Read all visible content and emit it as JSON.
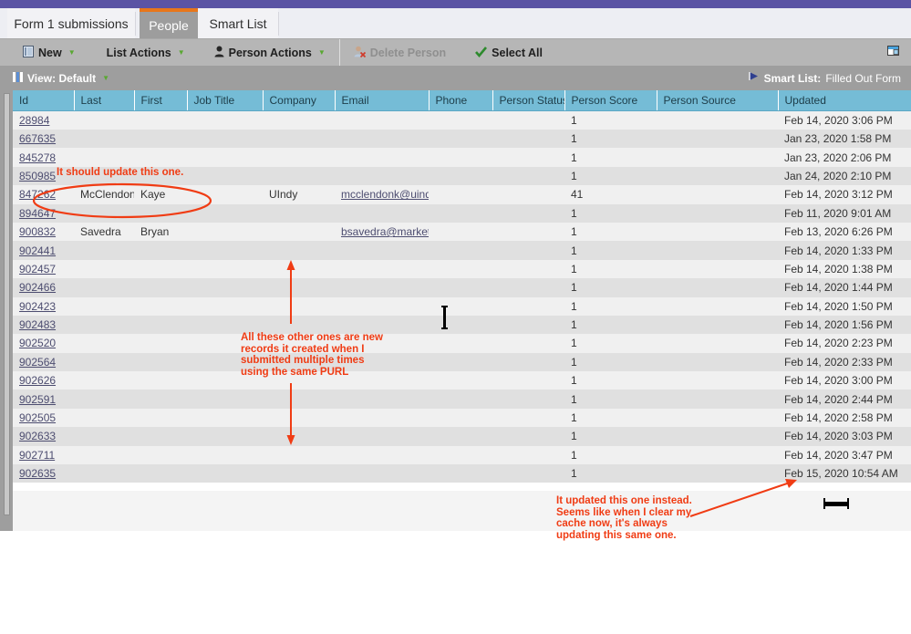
{
  "window": {
    "accent_purple": "#5b54a4",
    "active_tab_accent": "#e8761a",
    "annotation_color": "#f03c14"
  },
  "tabs": [
    {
      "label": "Form 1 submissions",
      "active": false
    },
    {
      "label": "People",
      "active": true
    },
    {
      "label": "Smart List",
      "active": false
    }
  ],
  "toolbar": {
    "new_label": "New",
    "list_actions_label": "List Actions",
    "person_actions_label": "Person Actions",
    "delete_person_label": "Delete Person",
    "select_all_label": "Select All",
    "new_icon": "document-icon",
    "person_icon": "person-icon",
    "delete_icon": "delete-person-icon",
    "select_all_icon": "checkmark-icon",
    "window_icon": "window-restore-icon"
  },
  "viewbar": {
    "view_icon": "columns-icon",
    "view_label": "View: Default",
    "smart_list_icon": "flag-icon",
    "smart_list_label": "Smart List:",
    "smart_list_value": "Filled Out Form"
  },
  "table": {
    "columns": [
      "Id",
      "Last",
      "First",
      "Job Title",
      "Company",
      "Email",
      "Phone",
      "Person Status",
      "Person Score",
      "Person Source",
      "Updated"
    ],
    "rows": [
      {
        "id": "28984",
        "last": "",
        "first": "",
        "job_title": "",
        "company": "",
        "email": "",
        "phone": "",
        "person_status": "",
        "person_score": "1",
        "person_source": "",
        "updated": "Feb 14, 2020 3:06 PM"
      },
      {
        "id": "667635",
        "last": "",
        "first": "",
        "job_title": "",
        "company": "",
        "email": "",
        "phone": "",
        "person_status": "",
        "person_score": "1",
        "person_source": "",
        "updated": "Jan 23, 2020 1:58 PM"
      },
      {
        "id": "845278",
        "last": "",
        "first": "",
        "job_title": "",
        "company": "",
        "email": "",
        "phone": "",
        "person_status": "",
        "person_score": "1",
        "person_source": "",
        "updated": "Jan 23, 2020 2:06 PM"
      },
      {
        "id": "850985",
        "last": "",
        "first": "",
        "job_title": "",
        "company": "",
        "email": "",
        "phone": "",
        "person_status": "",
        "person_score": "1",
        "person_source": "",
        "updated": "Jan 24, 2020 2:10 PM"
      },
      {
        "id": "847262",
        "last": "McClendon",
        "first": "Kaye",
        "job_title": "",
        "company": "UIndy",
        "email": "mcclendonk@uind...",
        "phone": "",
        "person_status": "",
        "person_score": "41",
        "person_source": "",
        "updated": "Feb 14, 2020 3:12 PM"
      },
      {
        "id": "894647",
        "last": "",
        "first": "",
        "job_title": "",
        "company": "",
        "email": "",
        "phone": "",
        "person_status": "",
        "person_score": "1",
        "person_source": "",
        "updated": "Feb 11, 2020 9:01 AM"
      },
      {
        "id": "900832",
        "last": "Savedra",
        "first": "Bryan",
        "job_title": "",
        "company": "",
        "email": "bsavedra@market...",
        "phone": "",
        "person_status": "",
        "person_score": "1",
        "person_source": "",
        "updated": "Feb 13, 2020 6:26 PM"
      },
      {
        "id": "902441",
        "last": "",
        "first": "",
        "job_title": "",
        "company": "",
        "email": "",
        "phone": "",
        "person_status": "",
        "person_score": "1",
        "person_source": "",
        "updated": "Feb 14, 2020 1:33 PM"
      },
      {
        "id": "902457",
        "last": "",
        "first": "",
        "job_title": "",
        "company": "",
        "email": "",
        "phone": "",
        "person_status": "",
        "person_score": "1",
        "person_source": "",
        "updated": "Feb 14, 2020 1:38 PM"
      },
      {
        "id": "902466",
        "last": "",
        "first": "",
        "job_title": "",
        "company": "",
        "email": "",
        "phone": "",
        "person_status": "",
        "person_score": "1",
        "person_source": "",
        "updated": "Feb 14, 2020 1:44 PM"
      },
      {
        "id": "902423",
        "last": "",
        "first": "",
        "job_title": "",
        "company": "",
        "email": "",
        "phone": "",
        "person_status": "",
        "person_score": "1",
        "person_source": "",
        "updated": "Feb 14, 2020 1:50 PM"
      },
      {
        "id": "902483",
        "last": "",
        "first": "",
        "job_title": "",
        "company": "",
        "email": "",
        "phone": "",
        "person_status": "",
        "person_score": "1",
        "person_source": "",
        "updated": "Feb 14, 2020 1:56 PM"
      },
      {
        "id": "902520",
        "last": "",
        "first": "",
        "job_title": "",
        "company": "",
        "email": "",
        "phone": "",
        "person_status": "",
        "person_score": "1",
        "person_source": "",
        "updated": "Feb 14, 2020 2:23 PM"
      },
      {
        "id": "902564",
        "last": "",
        "first": "",
        "job_title": "",
        "company": "",
        "email": "",
        "phone": "",
        "person_status": "",
        "person_score": "1",
        "person_source": "",
        "updated": "Feb 14, 2020 2:33 PM"
      },
      {
        "id": "902626",
        "last": "",
        "first": "",
        "job_title": "",
        "company": "",
        "email": "",
        "phone": "",
        "person_status": "",
        "person_score": "1",
        "person_source": "",
        "updated": "Feb 14, 2020 3:00 PM"
      },
      {
        "id": "902591",
        "last": "",
        "first": "",
        "job_title": "",
        "company": "",
        "email": "",
        "phone": "",
        "person_status": "",
        "person_score": "1",
        "person_source": "",
        "updated": "Feb 14, 2020 2:44 PM"
      },
      {
        "id": "902505",
        "last": "",
        "first": "",
        "job_title": "",
        "company": "",
        "email": "",
        "phone": "",
        "person_status": "",
        "person_score": "1",
        "person_source": "",
        "updated": "Feb 14, 2020 2:58 PM"
      },
      {
        "id": "902633",
        "last": "",
        "first": "",
        "job_title": "",
        "company": "",
        "email": "",
        "phone": "",
        "person_status": "",
        "person_score": "1",
        "person_source": "",
        "updated": "Feb 14, 2020 3:03 PM"
      },
      {
        "id": "902711",
        "last": "",
        "first": "",
        "job_title": "",
        "company": "",
        "email": "",
        "phone": "",
        "person_status": "",
        "person_score": "1",
        "person_source": "",
        "updated": "Feb 14, 2020 3:47 PM"
      },
      {
        "id": "902635",
        "last": "",
        "first": "",
        "job_title": "",
        "company": "",
        "email": "",
        "phone": "",
        "person_status": "",
        "person_score": "1",
        "person_source": "",
        "updated": "Feb 15, 2020 10:54 AM"
      }
    ]
  },
  "annotations": {
    "note_should_update": "It should update this one.",
    "note_new_records": "All these other ones are new\nrecords it created when I\nsubmitted multiple times\nusing the same PURL",
    "note_updated_instead": "It updated this one instead.\nSeems like when I clear my\ncache now, it's always\nupdating this same one."
  }
}
